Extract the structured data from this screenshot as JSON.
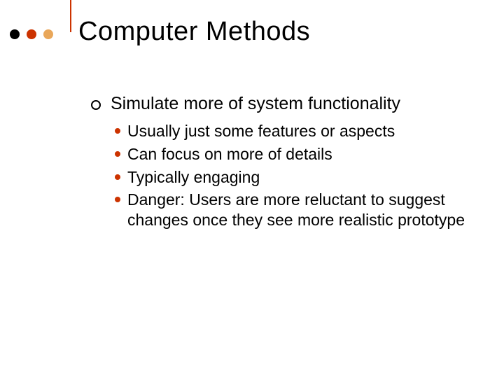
{
  "title": "Computer Methods",
  "main_point": "Simulate more of system functionality",
  "sub_points": [
    "Usually just some features or aspects",
    "Can focus on more of details",
    "Typically engaging",
    "Danger: Users are more reluctant to suggest changes once they see more realistic prototype"
  ]
}
